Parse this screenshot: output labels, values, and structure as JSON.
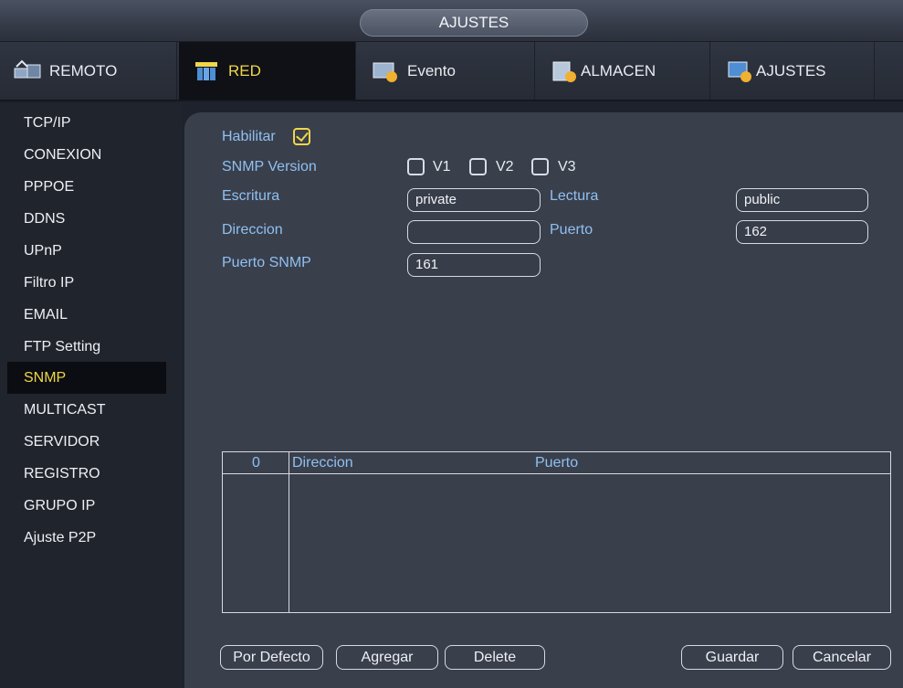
{
  "window": {
    "title": "AJUSTES"
  },
  "tabs": [
    {
      "label": "REMOTO",
      "icon": "remote-icon"
    },
    {
      "label": "RED",
      "icon": "network-icon",
      "active": true
    },
    {
      "label": "Evento",
      "icon": "event-icon"
    },
    {
      "label": "ALMACEN",
      "icon": "storage-icon"
    },
    {
      "label": "AJUSTES",
      "icon": "settings-icon"
    }
  ],
  "sidebar": {
    "items": [
      "TCP/IP",
      "CONEXION",
      "PPPOE",
      "DDNS",
      "UPnP",
      "Filtro IP",
      "EMAIL",
      "FTP Setting",
      "SNMP",
      "MULTICAST",
      "SERVIDOR",
      "REGISTRO",
      "GRUPO IP",
      "Ajuste P2P"
    ],
    "active": "SNMP"
  },
  "form": {
    "enable_label": "Habilitar",
    "enable_checked": true,
    "snmp_version_label": "SNMP Version",
    "versions": [
      {
        "label": "V1",
        "checked": false
      },
      {
        "label": "V2",
        "checked": false
      },
      {
        "label": "V3",
        "checked": false
      }
    ],
    "write_label": "Escritura",
    "write_value": "private",
    "read_label": "Lectura",
    "read_value": "public",
    "address_label": "Direccion",
    "address_value": "",
    "port_label": "Puerto",
    "port_value": "162",
    "snmp_port_label": "Puerto SNMP",
    "snmp_port_value": "161"
  },
  "table": {
    "headers": [
      "0",
      "Direccion",
      "Puerto"
    ],
    "rows": []
  },
  "buttons": {
    "default": "Por Defecto",
    "add": "Agregar",
    "delete": "Delete",
    "save": "Guardar",
    "cancel": "Cancelar"
  },
  "colors": {
    "active_text": "#f0d64a",
    "label_blue": "#8fc0f0",
    "panel_bg": "#3a3f4c"
  }
}
